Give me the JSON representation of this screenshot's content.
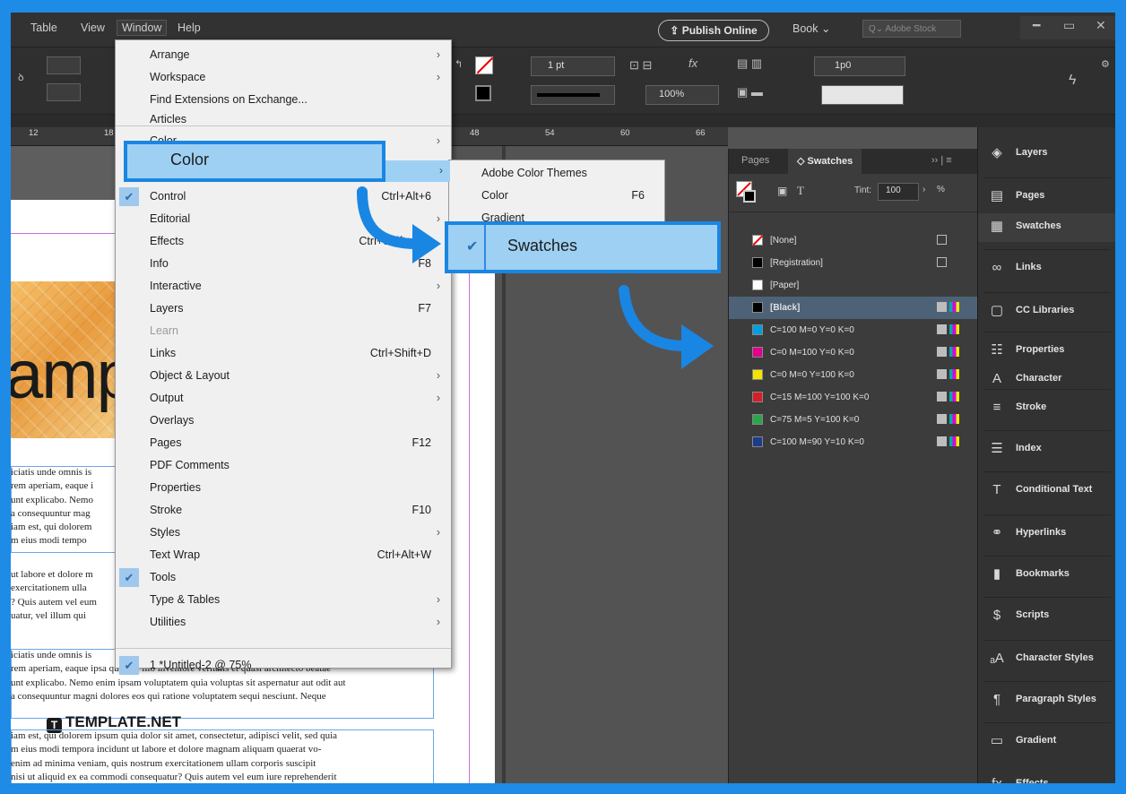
{
  "menubar": {
    "items": [
      "Table",
      "View",
      "Window",
      "Help"
    ],
    "publish_label": "Publish Online",
    "book_label": "Book",
    "search_placeholder": "Adobe Stock"
  },
  "controlbar": {
    "stroke_weight": "1 pt",
    "opacity": "100%",
    "offset": "1p0"
  },
  "ruler": {
    "ticks": [
      "12",
      "18",
      "48",
      "54",
      "60",
      "66"
    ]
  },
  "window_menu": {
    "items": [
      {
        "label": "Arrange",
        "shortcut": "",
        "submenu": true,
        "checked": false,
        "disabled": false
      },
      {
        "label": "Workspace",
        "shortcut": "",
        "submenu": true,
        "checked": false,
        "disabled": false
      },
      {
        "label": "Find Extensions on Exchange...",
        "shortcut": "",
        "submenu": false,
        "checked": false,
        "disabled": false
      },
      {
        "label": "Articles",
        "shortcut": "",
        "submenu": false,
        "checked": false,
        "disabled": false
      },
      {
        "label": "Color",
        "shortcut": "",
        "submenu": true,
        "checked": false,
        "disabled": false
      },
      {
        "label": "Control",
        "shortcut": "Ctrl+Alt+6",
        "submenu": false,
        "checked": true,
        "disabled": false
      },
      {
        "label": "Editorial",
        "shortcut": "",
        "submenu": true,
        "checked": false,
        "disabled": false
      },
      {
        "label": "Effects",
        "shortcut": "Ctrl+Shift+F10",
        "submenu": false,
        "checked": false,
        "disabled": false
      },
      {
        "label": "Info",
        "shortcut": "F8",
        "submenu": false,
        "checked": false,
        "disabled": false
      },
      {
        "label": "Interactive",
        "shortcut": "",
        "submenu": true,
        "checked": false,
        "disabled": false
      },
      {
        "label": "Layers",
        "shortcut": "F7",
        "submenu": false,
        "checked": false,
        "disabled": false
      },
      {
        "label": "Learn",
        "shortcut": "",
        "submenu": false,
        "checked": false,
        "disabled": true
      },
      {
        "label": "Links",
        "shortcut": "Ctrl+Shift+D",
        "submenu": false,
        "checked": false,
        "disabled": false
      },
      {
        "label": "Object & Layout",
        "shortcut": "",
        "submenu": true,
        "checked": false,
        "disabled": false
      },
      {
        "label": "Output",
        "shortcut": "",
        "submenu": true,
        "checked": false,
        "disabled": false
      },
      {
        "label": "Overlays",
        "shortcut": "",
        "submenu": false,
        "checked": false,
        "disabled": false
      },
      {
        "label": "Pages",
        "shortcut": "F12",
        "submenu": false,
        "checked": false,
        "disabled": false
      },
      {
        "label": "PDF Comments",
        "shortcut": "",
        "submenu": false,
        "checked": false,
        "disabled": false
      },
      {
        "label": "Properties",
        "shortcut": "",
        "submenu": false,
        "checked": false,
        "disabled": false
      },
      {
        "label": "Stroke",
        "shortcut": "F10",
        "submenu": false,
        "checked": false,
        "disabled": false
      },
      {
        "label": "Styles",
        "shortcut": "",
        "submenu": true,
        "checked": false,
        "disabled": false
      },
      {
        "label": "Text Wrap",
        "shortcut": "Ctrl+Alt+W",
        "submenu": false,
        "checked": false,
        "disabled": false
      },
      {
        "label": "Tools",
        "shortcut": "",
        "submenu": false,
        "checked": true,
        "disabled": false
      },
      {
        "label": "Type & Tables",
        "shortcut": "",
        "submenu": true,
        "checked": false,
        "disabled": false
      },
      {
        "label": "Utilities",
        "shortcut": "",
        "submenu": true,
        "checked": false,
        "disabled": false
      }
    ],
    "document_item": "1 *Untitled-2 @ 75%"
  },
  "color_submenu": {
    "items": [
      {
        "label": "Adobe Color Themes",
        "shortcut": ""
      },
      {
        "label": "Color",
        "shortcut": "F6"
      },
      {
        "label": "Gradient",
        "shortcut": ""
      }
    ],
    "highlighted": "Swatches"
  },
  "swatches_panel": {
    "tabs": [
      "Pages",
      "Swatches"
    ],
    "tint_label": "Tint:",
    "tint_value": "100",
    "tint_unit": "%",
    "swatches": [
      {
        "name": "[None]",
        "color": "#ffffff",
        "kind": "none"
      },
      {
        "name": "[Registration]",
        "color": "#000000",
        "kind": "registration"
      },
      {
        "name": "[Paper]",
        "color": "#ffffff",
        "kind": "paper"
      },
      {
        "name": "[Black]",
        "color": "#000000",
        "kind": "process"
      },
      {
        "name": "C=100 M=0 Y=0 K=0",
        "color": "#00a0e0",
        "kind": "process"
      },
      {
        "name": "C=0 M=100 Y=0 K=0",
        "color": "#e0008c",
        "kind": "process"
      },
      {
        "name": "C=0 M=0 Y=100 K=0",
        "color": "#f2e600",
        "kind": "process"
      },
      {
        "name": "C=15 M=100 Y=100 K=0",
        "color": "#d41f26",
        "kind": "process"
      },
      {
        "name": "C=75 M=5 Y=100 K=0",
        "color": "#2aa64a",
        "kind": "process"
      },
      {
        "name": "C=100 M=90 Y=10 K=0",
        "color": "#1e3a8c",
        "kind": "process"
      }
    ]
  },
  "dock": {
    "items": [
      {
        "label": "Layers",
        "icon": "layers-icon",
        "glyph": "◈"
      },
      {
        "label": "Pages",
        "icon": "pages-icon",
        "glyph": "▤"
      },
      {
        "label": "Swatches",
        "icon": "swatches-icon",
        "glyph": "▦"
      },
      {
        "label": "Links",
        "icon": "links-icon",
        "glyph": "∞"
      },
      {
        "label": "CC Libraries",
        "icon": "cc-libraries-icon",
        "glyph": "▢"
      },
      {
        "label": "Properties",
        "icon": "properties-icon",
        "glyph": "☷"
      },
      {
        "label": "Character",
        "icon": "character-icon",
        "glyph": "A"
      },
      {
        "label": "Stroke",
        "icon": "stroke-icon",
        "glyph": "≡"
      },
      {
        "label": "Index",
        "icon": "index-icon",
        "glyph": "☰"
      },
      {
        "label": "Conditional Text",
        "icon": "conditional-text-icon",
        "glyph": "T"
      },
      {
        "label": "Hyperlinks",
        "icon": "hyperlinks-icon",
        "glyph": "⚭"
      },
      {
        "label": "Bookmarks",
        "icon": "bookmarks-icon",
        "glyph": "▮"
      },
      {
        "label": "Scripts",
        "icon": "scripts-icon",
        "glyph": "$"
      },
      {
        "label": "Character Styles",
        "icon": "character-styles-icon",
        "glyph": "ₐA"
      },
      {
        "label": "Paragraph Styles",
        "icon": "paragraph-styles-icon",
        "glyph": "¶"
      },
      {
        "label": "Gradient",
        "icon": "gradient-icon",
        "glyph": "▭"
      },
      {
        "label": "Effects",
        "icon": "effects-icon",
        "glyph": "fx"
      }
    ]
  },
  "document": {
    "heading_fragment": "ampl",
    "logo_text": "TEMPLATE.NET",
    "body_lines_1": [
      "iciatis unde omnis is",
      "rem aperiam, eaque i",
      "unt explicabo. Nemo",
      "a consequuntur mag",
      "iam est, qui dolorem",
      "m eius modi tempo"
    ],
    "body_lines_2": [
      "ut labore et dolore m",
      "exercitationem ulla",
      "? Quis autem vel eum",
      "uatur, vel illum qui"
    ],
    "body_lines_3": [
      "iciatis unde omnis is",
      "rem aperiam, eaque ipsa quae ab illo inventore veritatis et quasi architecto beatae",
      "unt explicabo. Nemo enim ipsam voluptatem quia voluptas sit aspernatur aut odit aut",
      "a consequuntur magni dolores eos qui ratione voluptatem sequi nesciunt. Neque"
    ],
    "body_lines_4": [
      "iam est, qui dolorem ipsum quia dolor sit amet, consectetur, adipisci velit, sed quia",
      "m eius modi tempora incidunt ut labore et dolore magnam aliquam quaerat vo-",
      "enim ad minima veniam, quis nostrum exercitationem ullam corporis suscipit",
      "nisi ut aliquid ex ea commodi consequatur? Quis autem vel eum iure reprehenderit"
    ]
  },
  "colors": {
    "accent": "#1a86e3",
    "highlight": "#9ed0f3",
    "selected_row": "#4e6277"
  }
}
